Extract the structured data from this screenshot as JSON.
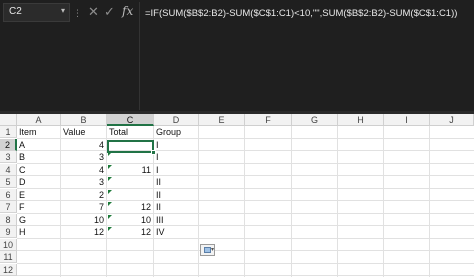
{
  "formula_bar": {
    "name_box": "C2",
    "name_box_arrow": "▾",
    "dots": "⋮",
    "cancel_symbol": "✕",
    "enter_symbol": "✓",
    "insert_function_symbol": "fx",
    "formula": "=IF(SUM($B$2:B2)-SUM($C$1:C1)<10,\"\",SUM($B$2:B2)-SUM($C$1:C1))"
  },
  "columns": [
    "A",
    "B",
    "C",
    "D",
    "E",
    "F",
    "G",
    "H",
    "I",
    "J"
  ],
  "selected_column": "C",
  "rows": [
    "1",
    "2",
    "3",
    "4",
    "5",
    "6",
    "7",
    "8",
    "9",
    "10",
    "11",
    "12"
  ],
  "selected_row": "2",
  "headers": {
    "a": "Item",
    "b": "Value",
    "c": "Total",
    "d": "Group"
  },
  "data_rows": [
    {
      "item": "A",
      "value": "4",
      "total": "",
      "group": "I"
    },
    {
      "item": "B",
      "value": "3",
      "total": "",
      "group": "I"
    },
    {
      "item": "C",
      "value": "4",
      "total": "11",
      "group": "I"
    },
    {
      "item": "D",
      "value": "3",
      "total": "",
      "group": "II"
    },
    {
      "item": "E",
      "value": "2",
      "total": "",
      "group": "II"
    },
    {
      "item": "F",
      "value": "7",
      "total": "12",
      "group": "II"
    },
    {
      "item": "G",
      "value": "10",
      "total": "10",
      "group": "III"
    },
    {
      "item": "H",
      "value": "12",
      "total": "12",
      "group": "IV"
    }
  ],
  "colors": {
    "accent": "#217346",
    "error_indicator": "#1e7b3a"
  }
}
